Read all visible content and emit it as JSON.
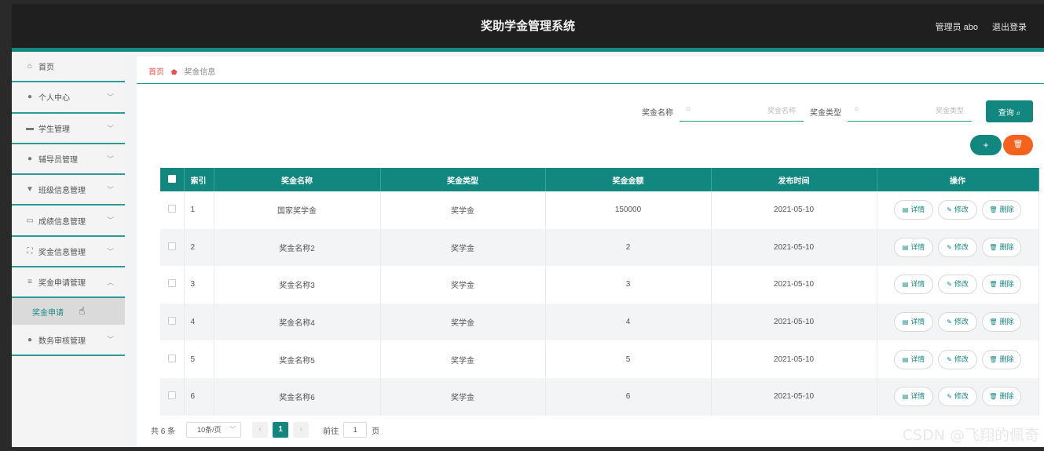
{
  "header": {
    "title": "奖助学金管理系统",
    "admin_label": "管理员 abo",
    "logout_label": "退出登录"
  },
  "sidebar": {
    "items": [
      {
        "label": "首页",
        "icon": "home-icon",
        "glyph": "⌂"
      },
      {
        "label": "个人中心",
        "icon": "user-icon",
        "glyph": "●"
      },
      {
        "label": "学生管理",
        "icon": "briefcase-icon",
        "glyph": "▬"
      },
      {
        "label": "辅导员管理",
        "icon": "person-icon",
        "glyph": "●"
      },
      {
        "label": "班级信息管理",
        "icon": "flag-icon",
        "glyph": "▼"
      },
      {
        "label": "成绩信息管理",
        "icon": "chart-icon",
        "glyph": "▭"
      },
      {
        "label": "奖金信息管理",
        "icon": "expand-icon",
        "glyph": "⛶"
      },
      {
        "label": "奖金申请管理",
        "icon": "list-icon",
        "glyph": "≡"
      }
    ],
    "submenu_item": "奖金申请",
    "last_item": {
      "label": "数务审核管理",
      "icon": "pin-icon",
      "glyph": "●"
    }
  },
  "breadcrumb": {
    "home": "首页",
    "current": "奖金信息"
  },
  "search": {
    "name_label": "奖金名称",
    "name_placeholder": "奖金名称",
    "type_label": "奖金类型",
    "type_placeholder": "奖金类型",
    "query_button": "查询 ⌕"
  },
  "actions": {
    "add": "+",
    "delete": "🗑"
  },
  "table": {
    "headers": [
      "索引",
      "奖金名称",
      "奖金类型",
      "奖金金额",
      "发布时间",
      "操作"
    ],
    "rows": [
      [
        "1",
        "国家奖学金",
        "奖学金",
        "150000",
        "2021-05-10"
      ],
      [
        "2",
        "奖金名称2",
        "奖学金",
        "2",
        "2021-05-10"
      ],
      [
        "3",
        "奖金名称3",
        "奖学金",
        "3",
        "2021-05-10"
      ],
      [
        "4",
        "奖金名称4",
        "奖学金",
        "4",
        "2021-05-10"
      ],
      [
        "5",
        "奖金名称5",
        "奖学金",
        "5",
        "2021-05-10"
      ],
      [
        "6",
        "奖金名称6",
        "奖学金",
        "6",
        "2021-05-10"
      ]
    ],
    "row_actions": {
      "detail": "详情",
      "edit": "修改",
      "delete": "删除"
    }
  },
  "pagination": {
    "total": "共 6 条",
    "page_size": "10条/页",
    "current_page": "1",
    "goto_label": "前往",
    "goto_value": "1",
    "page_suffix": "页"
  },
  "watermark": "CSDN @飞翔的佩奇",
  "colors": {
    "accent": "#12877f",
    "danger": "#f5621e",
    "topbar": "#1f1f1f"
  }
}
